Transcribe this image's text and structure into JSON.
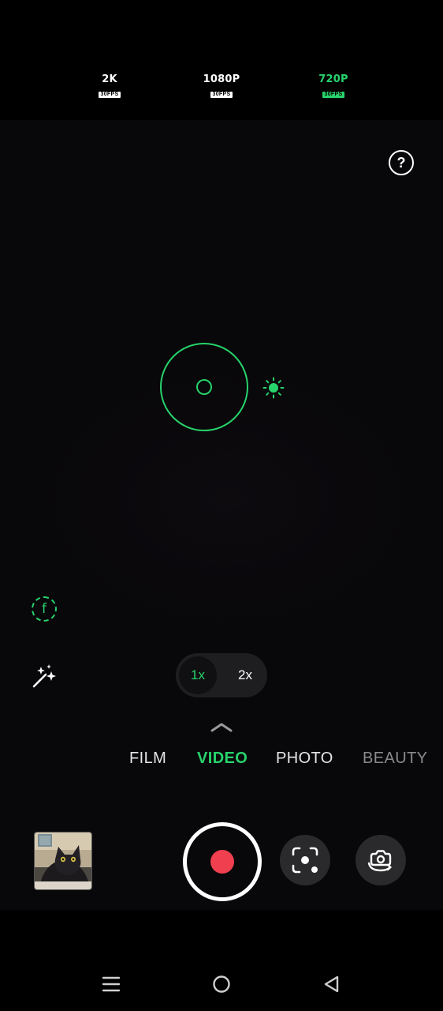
{
  "resolutions": [
    {
      "label": "2K",
      "fps": "30FPS",
      "active": false
    },
    {
      "label": "1080P",
      "fps": "30FPS",
      "active": false
    },
    {
      "label": "720P",
      "fps": "30FPS",
      "active": true
    }
  ],
  "help": {
    "label": "?"
  },
  "filter": {
    "label": "f"
  },
  "zoom": {
    "options": [
      "1x",
      "2x"
    ],
    "selected": "1x"
  },
  "modes": [
    "FILM",
    "VIDEO",
    "PHOTO",
    "BEAUTY"
  ],
  "active_mode": "VIDEO",
  "colors": {
    "accent": "#27d36b",
    "record": "#f0404f",
    "background": "#000000"
  },
  "icons": {
    "exposure": "sun-icon",
    "magic": "sparkles-icon",
    "scan": "lens-scan-icon",
    "flip": "flip-camera-icon",
    "nav": [
      "menu-icon",
      "home-icon",
      "back-icon"
    ]
  }
}
